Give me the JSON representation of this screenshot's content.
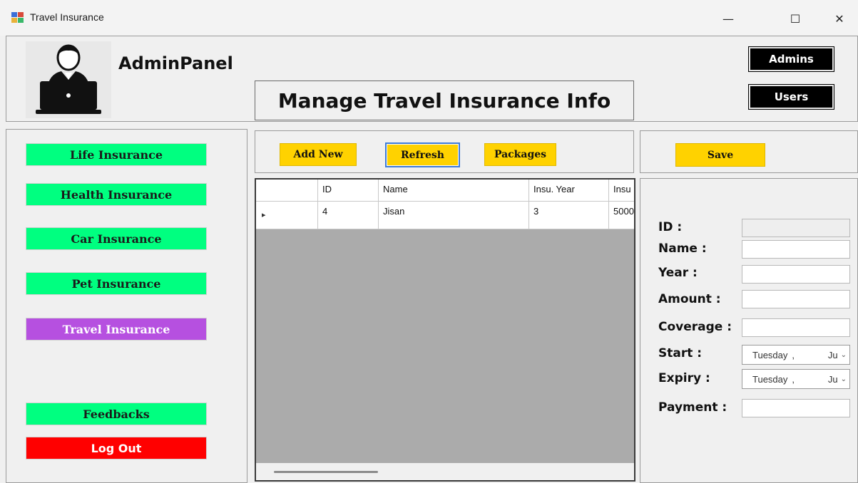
{
  "window": {
    "title": "Travel Insurance",
    "minimize": "—",
    "maximize": "☐",
    "close": "✕"
  },
  "header": {
    "app_name": "AdminPanel",
    "page_title": "Manage Travel Insurance Info",
    "admins_label": "Admins",
    "users_label": "Users"
  },
  "sidebar": {
    "items": [
      {
        "label": "Life Insurance"
      },
      {
        "label": "Health Insurance"
      },
      {
        "label": "Car Insurance"
      },
      {
        "label": "Pet Insurance"
      },
      {
        "label": "Travel Insurance"
      },
      {
        "label": "Feedbacks"
      },
      {
        "label": "Log Out"
      }
    ]
  },
  "toolbar": {
    "add_new": "Add New",
    "refresh": "Refresh",
    "packages": "Packages"
  },
  "grid": {
    "headers": [
      "ID",
      "Name",
      "Insu. Year",
      "Insu"
    ],
    "rows": [
      {
        "marker": "▸",
        "cells": [
          "4",
          "Jisan",
          "3",
          "5000"
        ]
      }
    ]
  },
  "form": {
    "save": "Save",
    "labels": {
      "id": "ID :",
      "name": "Name :",
      "year": "Year :",
      "amount": "Amount :",
      "coverage": "Coverage :",
      "start": "Start :",
      "expiry": "Expiry :",
      "payment": "Payment :"
    },
    "start_date": {
      "day": "Tuesday",
      "sep": ",",
      "month": "Ju"
    },
    "expiry_date": {
      "day": "Tuesday",
      "sep": ",",
      "month": "Ju"
    }
  },
  "colors": {
    "accent_green": "#00ff80",
    "accent_purple": "#b650e0",
    "accent_red": "#ff0000",
    "accent_yellow": "#ffd200"
  }
}
